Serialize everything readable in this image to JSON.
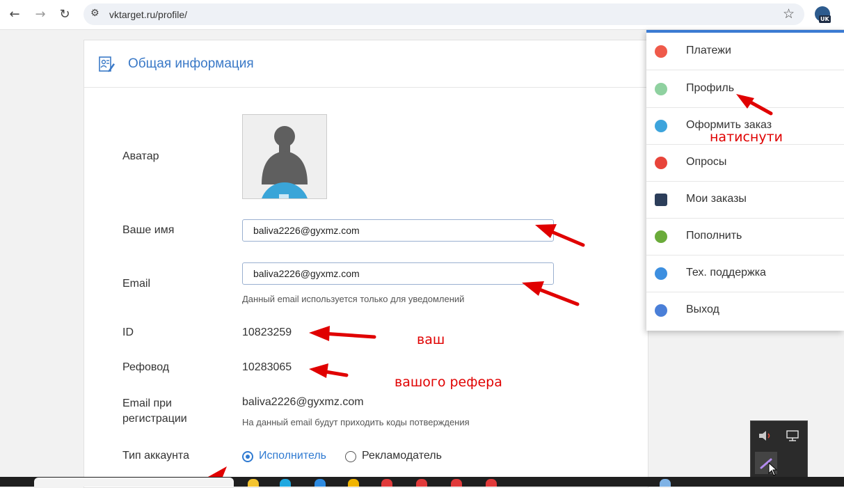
{
  "browser": {
    "url": "vktarget.ru/profile/",
    "back_icon": "←",
    "forward_icon": "→",
    "reload_icon": "↻",
    "site_info_icon": "⚙",
    "bookmark_icon": "☆",
    "extension_badge": "UK"
  },
  "card": {
    "title": "Общая информация"
  },
  "profile": {
    "avatar_label": "Аватар",
    "name_label": "Ваше имя",
    "name_value": "baliva2226@gyxmz.com",
    "email_label": "Email",
    "email_value": "baliva2226@gyxmz.com",
    "email_hint": "Данный email используется только для уведомлений",
    "id_label": "ID",
    "id_value": "10823259",
    "referrer_label": "Рефовод",
    "referrer_value": "10283065",
    "reg_email_label_line1": "Email при",
    "reg_email_label_line2": "регистрации",
    "reg_email_value": "baliva2226@gyxmz.com",
    "reg_email_hint": "На данный email будут приходить коды потверждения",
    "account_type_label": "Тип аккаунта",
    "account_type_options": [
      "Исполнитель",
      "Рекламодатель"
    ],
    "account_type_selected": "Исполнитель"
  },
  "menu": {
    "items": [
      {
        "label": "Платежи",
        "icon": "payments-icon",
        "color": "#ef5a4a"
      },
      {
        "label": "Профиль",
        "icon": "profile-icon",
        "color": "#8fd1a0"
      },
      {
        "label": "Оформить заказ",
        "icon": "order-icon",
        "color": "#3da4dc"
      },
      {
        "label": "Опросы",
        "icon": "surveys-icon",
        "color": "#e8443a"
      },
      {
        "label": "Мои заказы",
        "icon": "my-orders-icon",
        "color": "#2c3e5a"
      },
      {
        "label": "Пополнить",
        "icon": "topup-icon",
        "color": "#6aab3a"
      },
      {
        "label": "Тех. поддержка",
        "icon": "support-icon",
        "color": "#3d8fe0"
      },
      {
        "label": "Выход",
        "icon": "logout-icon",
        "color": "#4a7fd8"
      }
    ]
  },
  "annotations": {
    "click_note": "натиснути",
    "your_id_note": "ваш",
    "referrer_note": "вашого рефера"
  },
  "colors": {
    "accent": "#3a79c7",
    "annotation_red": "#e00000"
  }
}
